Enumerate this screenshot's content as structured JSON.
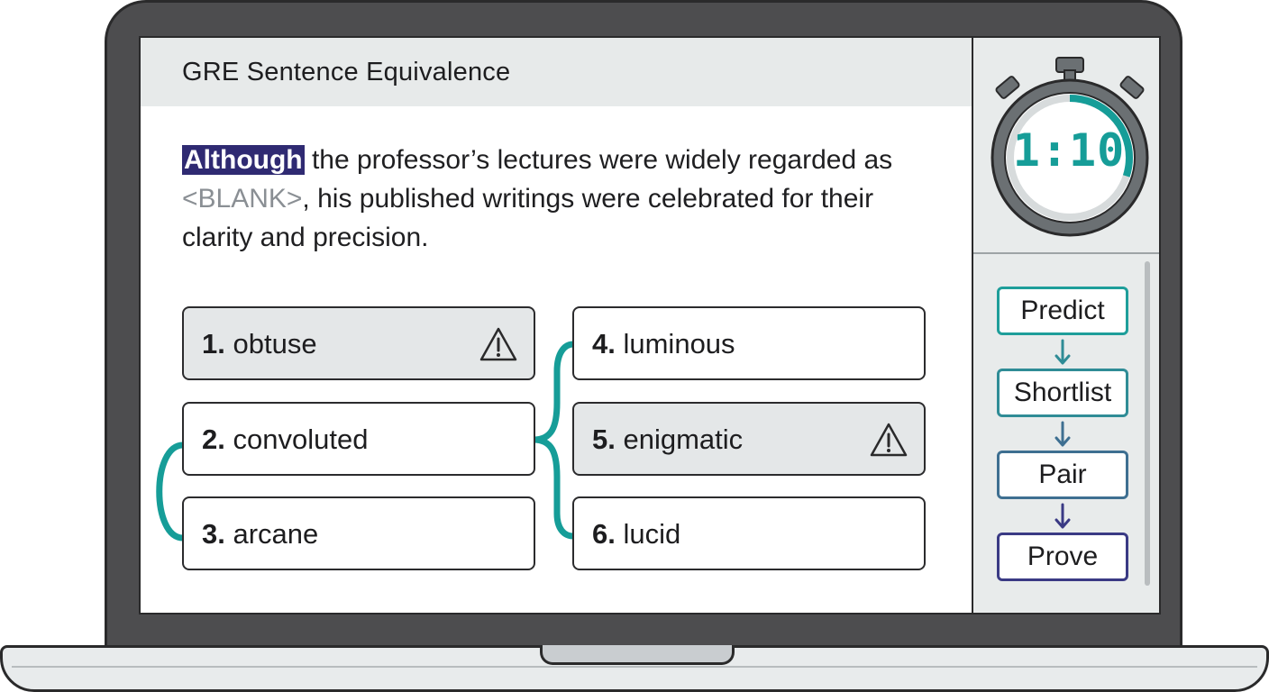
{
  "header": {
    "title": "GRE Sentence Equivalence"
  },
  "question": {
    "highlight": "Although",
    "before_blank": " the professor’s lectures were widely regarded as ",
    "blank": "<BLANK>",
    "after_blank": ", his published writings were celebrated for their clarity and precision."
  },
  "choices": [
    {
      "num": "1.",
      "word": "obtuse",
      "flagged": true
    },
    {
      "num": "2.",
      "word": "convoluted",
      "flagged": false
    },
    {
      "num": "3.",
      "word": "arcane",
      "flagged": false
    },
    {
      "num": "4.",
      "word": "luminous",
      "flagged": false
    },
    {
      "num": "5.",
      "word": "enigmatic",
      "flagged": true
    },
    {
      "num": "6.",
      "word": "lucid",
      "flagged": false
    }
  ],
  "timer": {
    "display": "1:10",
    "progress": 0.3
  },
  "steps": [
    {
      "label": "Predict",
      "color": "#1e9e9a"
    },
    {
      "label": "Shortlist",
      "color": "#2f8c96"
    },
    {
      "label": "Pair",
      "color": "#3e6f91"
    },
    {
      "label": "Prove",
      "color": "#3a3a84"
    }
  ],
  "colors": {
    "accent_teal": "#169d98",
    "highlight_bg": "#2f2a72",
    "flag_icon": "warning-icon"
  }
}
